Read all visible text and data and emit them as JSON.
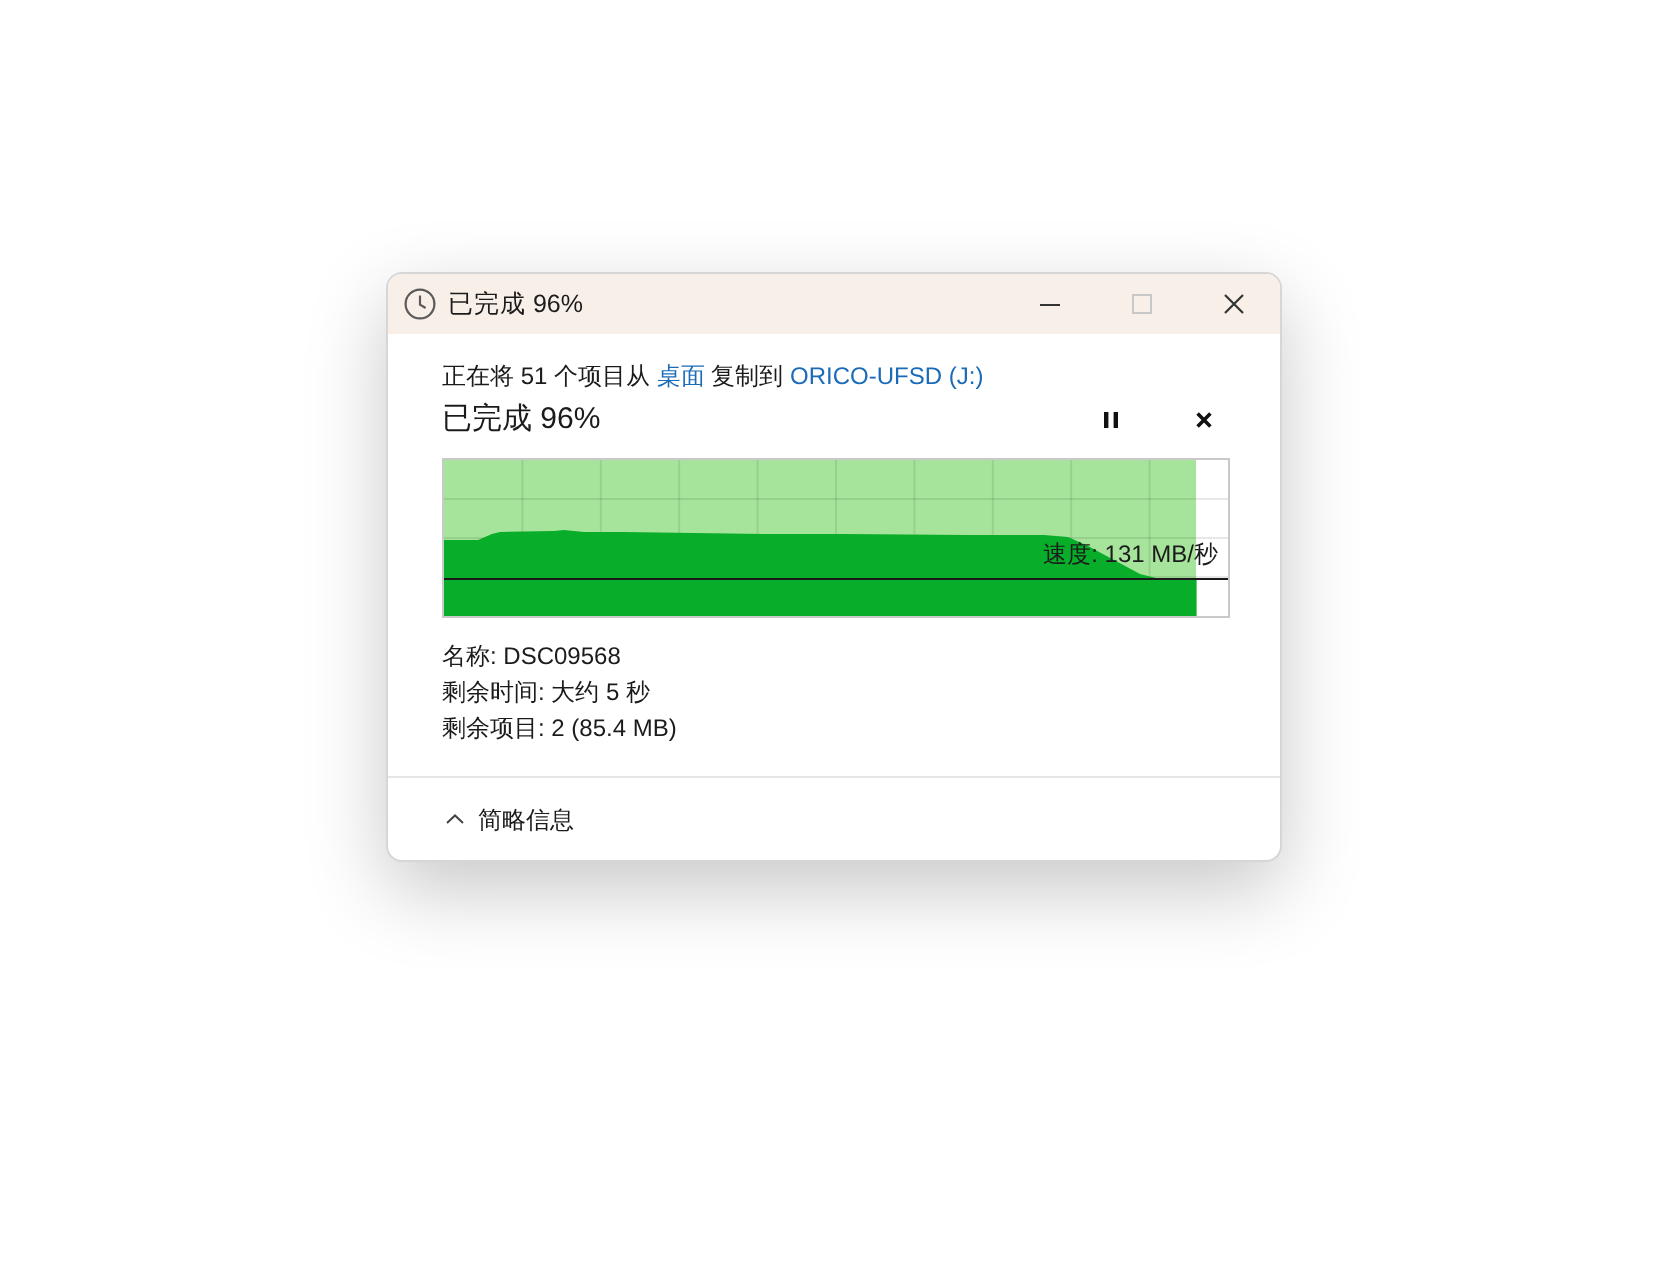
{
  "window": {
    "title": "已完成 96%",
    "controls": [
      {
        "kind": "minimize",
        "disabled": false
      },
      {
        "kind": "maximize",
        "disabled": true
      },
      {
        "kind": "close",
        "disabled": false
      }
    ]
  },
  "copy_summary": {
    "prefix": "正在将 51 个项目从",
    "source": "桌面",
    "middle": "复制到",
    "destination": "ORICO-UFSD (J:)"
  },
  "progress": {
    "heading": "已完成 96%",
    "level": 0.96,
    "speed": "速度: 131 MB/秒"
  },
  "details": [
    "名称: DSC09568",
    "剩余时间: 大约 5 秒",
    "剩余项目: 2 (85.4 MB)"
  ],
  "footer": {
    "toggle": "简略信息",
    "expanded": true
  }
}
